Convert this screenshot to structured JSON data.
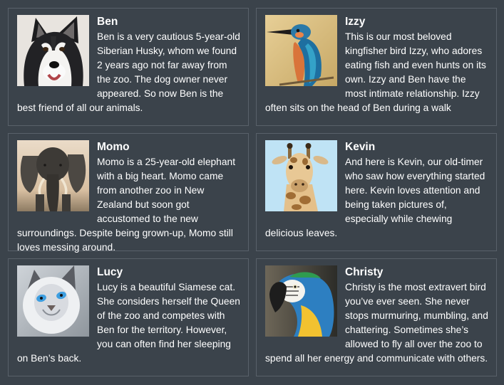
{
  "animals": [
    {
      "name": "Ben",
      "photo": "siberian-husky-photo",
      "description": "Ben is a very cautious 5-year-old Siberian Husky, whom we found 2 years ago not far away from the zoo. The dog owner never appeared. So now Ben is the best friend of all our animals."
    },
    {
      "name": "Izzy",
      "photo": "kingfisher-photo",
      "description": "This is our most beloved kingfisher bird Izzy, who adores eating fish and even hunts on its own. Izzy and Ben have the most intimate relationship. Izzy often sits on the head of Ben during a walk"
    },
    {
      "name": "Momo",
      "photo": "elephant-photo",
      "description": "Momo is a 25-year-old elephant with a big heart. Momo came from another zoo in New Zealand but soon got accustomed to the new surroundings. Despite being grown-up, Momo still loves messing around."
    },
    {
      "name": "Kevin",
      "photo": "giraffe-photo",
      "description": "And here is Kevin, our old-timer who saw how everything started here. Kevin loves attention and being taken pictures of, especially while chewing delicious leaves."
    },
    {
      "name": "Lucy",
      "photo": "siamese-cat-photo",
      "description": "Lucy is a beautiful Siamese cat. She considers herself the Queen of the zoo and competes with Ben for the territory. However, you can often find her sleeping on Ben’s back."
    },
    {
      "name": "Christy",
      "photo": "macaw-parrot-photo",
      "description": "Christy is the most extravert bird you’ve ever seen. She never stops murmuring, mumbling, and chattering. Sometimes she’s allowed to fly all over the zoo to spend all her energy and communicate with others."
    }
  ]
}
